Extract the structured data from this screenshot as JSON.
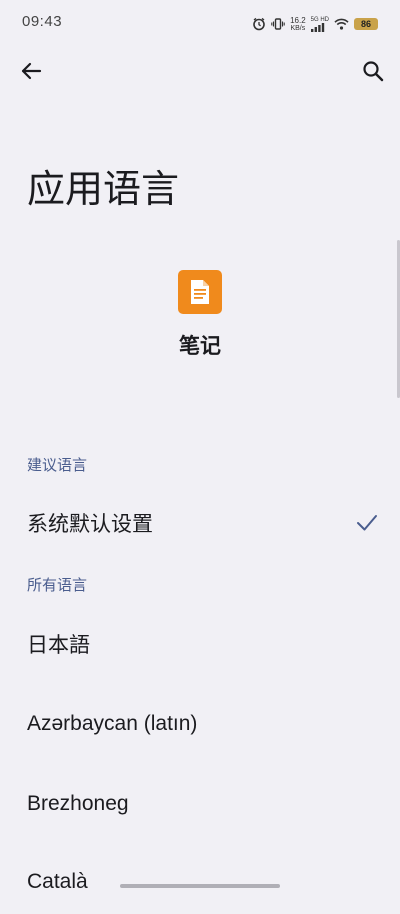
{
  "status_bar": {
    "time": "09:43",
    "net_speed_value": "16.2",
    "net_speed_unit": "KB/s",
    "network_label": "5G HD",
    "battery": "86"
  },
  "toolbar": {
    "back_icon": "arrow-left-icon",
    "search_icon": "search-icon"
  },
  "page": {
    "title": "应用语言"
  },
  "app": {
    "name": "笔记",
    "icon": "notes-app-icon",
    "icon_color": "#f08a1c"
  },
  "sections": {
    "suggested_header": "建议语言",
    "all_header": "所有语言"
  },
  "suggested_languages": [
    {
      "label": "系统默认设置",
      "selected": true
    }
  ],
  "all_languages": [
    {
      "label": "日本語"
    },
    {
      "label": "Azərbaycan (latın)"
    },
    {
      "label": "Brezhoneg"
    },
    {
      "label": "Català"
    }
  ],
  "colors": {
    "background": "#f1f0f5",
    "section_header": "#4a5d8e",
    "check": "#4a5d8e"
  }
}
